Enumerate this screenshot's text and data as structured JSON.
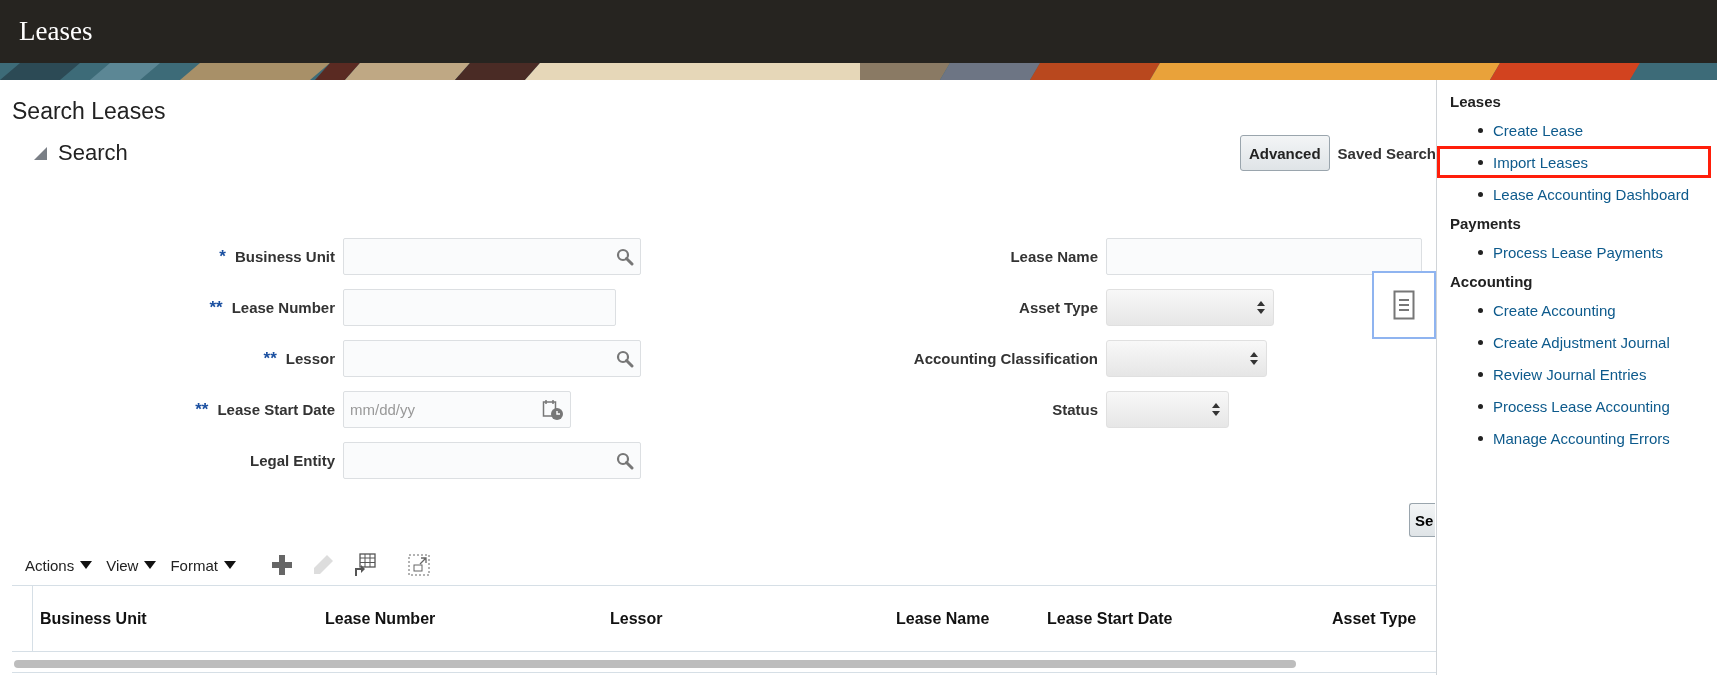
{
  "app_title": "Leases",
  "page_title": "Search Leases",
  "search_section": {
    "title": "Search",
    "expanded": true,
    "advanced_button": "Advanced",
    "saved_search_label": "Saved Search",
    "left_fields": [
      {
        "label": "Business Unit",
        "required": "*",
        "kind": "lookup"
      },
      {
        "label": "Lease Number",
        "required": "**",
        "kind": "text"
      },
      {
        "label": "Lessor",
        "required": "**",
        "kind": "lookup"
      },
      {
        "label": "Lease Start Date",
        "required": "**",
        "kind": "date",
        "placeholder": "mm/dd/yy"
      },
      {
        "label": "Legal Entity",
        "kind": "lookup"
      }
    ],
    "right_fields": [
      {
        "label": "Lease Name",
        "kind": "text"
      },
      {
        "label": "Asset Type",
        "kind": "select"
      },
      {
        "label": "Accounting Classification",
        "kind": "select"
      },
      {
        "label": "Status",
        "kind": "select"
      }
    ],
    "search_button": "Se"
  },
  "toolbar": {
    "menus": [
      "Actions",
      "View",
      "Format"
    ]
  },
  "table": {
    "columns": [
      "Business Unit",
      "Lease Number",
      "Lessor",
      "Lease Name",
      "Lease Start Date",
      "Asset Type"
    ]
  },
  "tasks_panel": {
    "sections": [
      {
        "heading": "Leases",
        "links": [
          {
            "label": "Create Lease",
            "highlighted": false
          },
          {
            "label": "Import Leases",
            "highlighted": true
          },
          {
            "label": "Lease Accounting Dashboard",
            "highlighted": false
          }
        ]
      },
      {
        "heading": "Payments",
        "links": [
          {
            "label": "Process Lease Payments",
            "highlighted": false
          }
        ]
      },
      {
        "heading": "Accounting",
        "links": [
          {
            "label": "Create Accounting",
            "highlighted": false
          },
          {
            "label": "Create Adjustment Journal",
            "highlighted": false
          },
          {
            "label": "Review Journal Entries",
            "highlighted": false
          },
          {
            "label": "Process Lease Accounting",
            "highlighted": false
          },
          {
            "label": "Manage Accounting Errors",
            "highlighted": false
          }
        ]
      }
    ]
  }
}
